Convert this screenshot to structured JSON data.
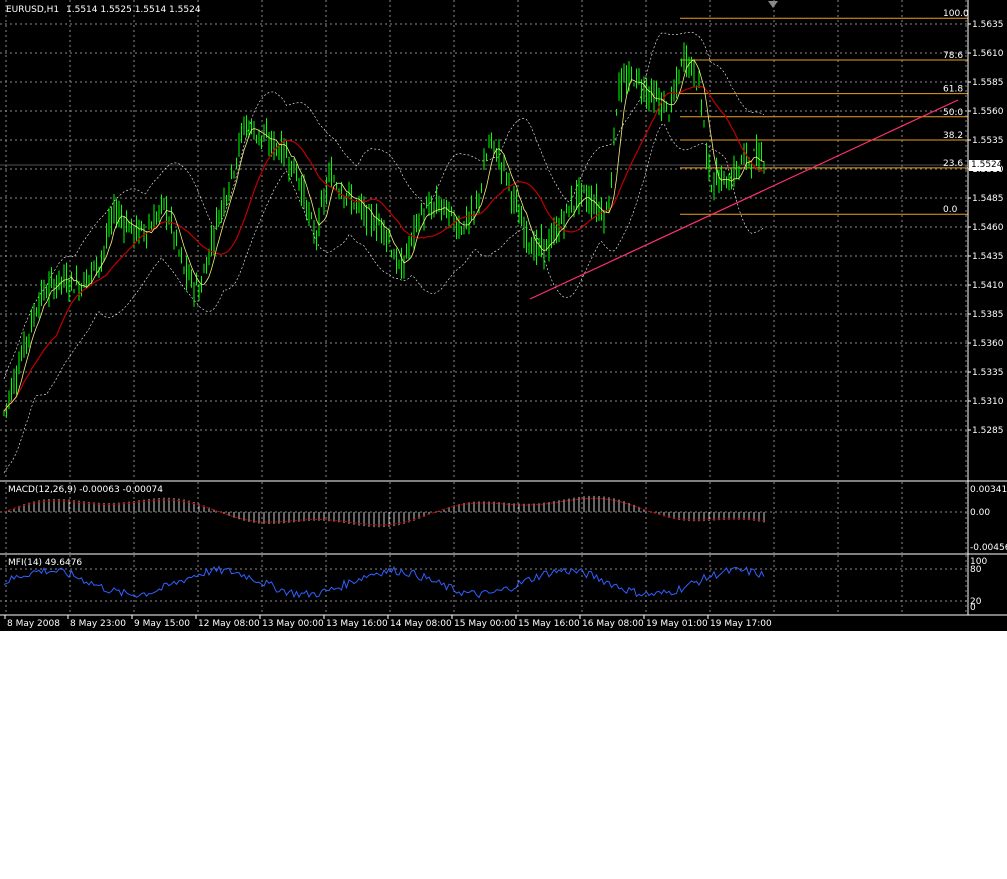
{
  "header": {
    "symbol_period": "EURUSD,H1",
    "ohlc": "1.5514 1.5525 1.5514 1.5524",
    "current_price": "1.5524"
  },
  "price_axis": {
    "labels": [
      "1.5635",
      "1.5610",
      "1.5585",
      "1.5560",
      "1.5535",
      "1.5510",
      "1.5485",
      "1.5460",
      "1.5435",
      "1.5410",
      "1.5385",
      "1.5360",
      "1.5335",
      "1.5310",
      "1.5285"
    ]
  },
  "fibonacci": {
    "color": "#e8a020",
    "levels": [
      {
        "label": "100.0",
        "price": 1.564
      },
      {
        "label": "78.6",
        "price": 1.5604
      },
      {
        "label": "61.8",
        "price": 1.5575
      },
      {
        "label": "50.0",
        "price": 1.5555
      },
      {
        "label": "38.2",
        "price": 1.5535
      },
      {
        "label": "23.6",
        "price": 1.5511
      },
      {
        "label": "0.0",
        "price": 1.5471
      }
    ]
  },
  "macd": {
    "label": "MACD(12,26,9) -0.00063 -0.00074",
    "axis_labels": [
      "0.00341",
      "0.00",
      "-0.00456"
    ]
  },
  "mfi": {
    "label": "MFI(14) 49.6476",
    "axis_labels": [
      "100",
      "80",
      "20",
      "0"
    ]
  },
  "time_axis": {
    "labels": [
      "8 May 2008",
      "8 May 23:00",
      "9 May 15:00",
      "12 May 08:00",
      "13 May 00:00",
      "13 May 16:00",
      "14 May 08:00",
      "15 May 00:00",
      "15 May 16:00",
      "16 May 08:00",
      "19 May 01:00",
      "19 May 17:00"
    ]
  },
  "colors": {
    "background": "#000000",
    "grid": "#8a8a8a",
    "candles": "#00ff00",
    "ma_red": "#c00000",
    "ma_yellow": "#f0f080",
    "bands": "#ffffff",
    "trendline": "#ff3070",
    "macd_signal": "#c00000",
    "mfi_line": "#3060ff"
  },
  "icons": {
    "shift_marker": "shift-triangle-icon"
  }
}
